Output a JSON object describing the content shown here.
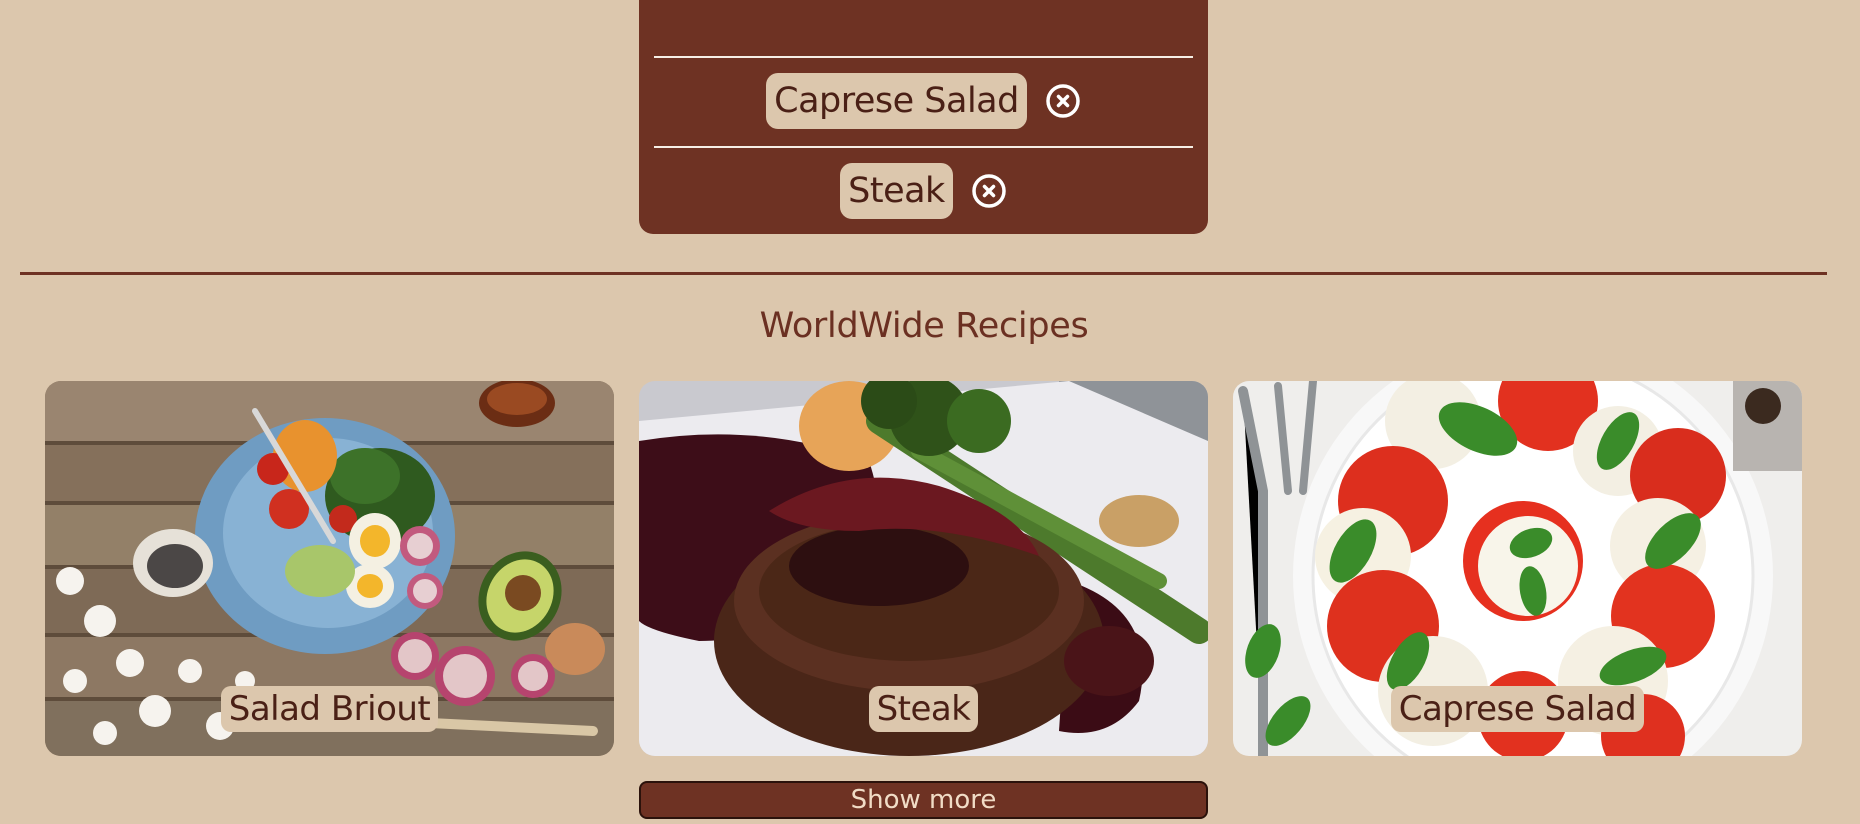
{
  "favorites": {
    "items": [
      {
        "name": "Caprese Salad",
        "remove_icon": "close-circle-icon"
      },
      {
        "name": "Steak",
        "remove_icon": "close-circle-icon"
      }
    ]
  },
  "recipes_section": {
    "title": "WorldWide Recipes",
    "cards": [
      {
        "name": "Salad Briout",
        "image": "salad-bowl-photo"
      },
      {
        "name": "Steak",
        "image": "steak-photo"
      },
      {
        "name": "Caprese Salad",
        "image": "caprese-salad-photo"
      }
    ],
    "show_more_label": "Show more"
  },
  "colors": {
    "background": "#dcc7ad",
    "accent": "#6e3223",
    "chip": "#dcc7ad",
    "text_dark": "#4a2016"
  }
}
